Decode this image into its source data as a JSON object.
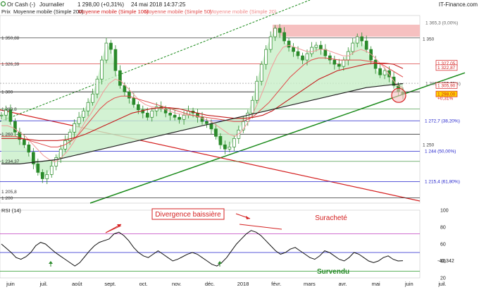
{
  "header": {
    "instrument": "Or Cash (-)",
    "period": "Journalier",
    "quote": "1 298,00 (+0,31%)",
    "datetime": "24 mai 2018 14:37:25",
    "source": "IT-Finance.com"
  },
  "legend": {
    "prefix": "Prix",
    "items": [
      {
        "label": "Moyenne mobile (Simple 200)",
        "color": "#222222"
      },
      {
        "label": "Moyenne mobile (Simple 100)",
        "color": "#d42020"
      },
      {
        "label": "Moyenne mobile (Simple 50)",
        "color": "#e05050"
      },
      {
        "label": "Moyenne mobile (Simple 20)",
        "color": "#f08a8a"
      }
    ]
  },
  "colors": {
    "candle_up": "#2a8a2a",
    "candle_down": "#2a8a2a",
    "sma200": "#222222",
    "sma100": "#c41a1a",
    "sma50": "#e04848",
    "sma20": "#f29a9a",
    "support_line": "#1a8a1a",
    "resistance_line": "#d42020",
    "fib_line": "#2222cc",
    "rsi_line": "#111111",
    "rsi_upper": "#c040c0",
    "rsi_lower": "#2a9a2a",
    "annotation_red": "#d42020",
    "annotation_green": "#2a8a2a",
    "zone_red": "#f6c0c0",
    "zone_green": "#c8efc8"
  },
  "chart_data": {
    "type": "candlestick",
    "x_labels": [
      "juin",
      "juil.",
      "août",
      "sept.",
      "oct.",
      "nov.",
      "déc.",
      "2018",
      "févr.",
      "mars",
      "avr.",
      "mai",
      "juin",
      "juil."
    ],
    "y_ticks": [
      "1 350",
      "1 300",
      "1 250",
      "1 200"
    ],
    "ylim": [
      1195,
      1372
    ],
    "price_series": [
      1278,
      1283,
      1272,
      1262,
      1255,
      1250,
      1243,
      1232,
      1224,
      1218,
      1222,
      1230,
      1238,
      1246,
      1254,
      1262,
      1270,
      1276,
      1282,
      1290,
      1298,
      1312,
      1330,
      1346,
      1340,
      1320,
      1306,
      1300,
      1294,
      1288,
      1283,
      1280,
      1276,
      1282,
      1286,
      1284,
      1280,
      1278,
      1276,
      1274,
      1278,
      1282,
      1280,
      1276,
      1272,
      1270,
      1265,
      1258,
      1250,
      1246,
      1248,
      1256,
      1264,
      1272,
      1280,
      1292,
      1310,
      1326,
      1340,
      1352,
      1360,
      1356,
      1348,
      1342,
      1338,
      1334,
      1330,
      1336,
      1342,
      1344,
      1340,
      1334,
      1330,
      1326,
      1324,
      1330,
      1338,
      1346,
      1352,
      1348,
      1340,
      1330,
      1322,
      1316,
      1320,
      1314,
      1306,
      1300,
      1298
    ],
    "sma20": [
      1268,
      1268,
      1266,
      1262,
      1258,
      1252,
      1246,
      1240,
      1236,
      1234,
      1238,
      1244,
      1252,
      1262,
      1272,
      1280,
      1290,
      1300,
      1308,
      1312,
      1310,
      1304,
      1298,
      1292,
      1288,
      1286,
      1285,
      1284,
      1282,
      1280,
      1279,
      1278,
      1278,
      1276,
      1274,
      1272,
      1268,
      1264,
      1260,
      1258,
      1262,
      1270,
      1280,
      1292,
      1306,
      1322,
      1334,
      1342,
      1344,
      1342,
      1340,
      1338,
      1338,
      1340,
      1340,
      1338,
      1336,
      1334,
      1334,
      1338,
      1340,
      1338,
      1334,
      1328,
      1322,
      1314,
      1306,
      1304
    ],
    "sma50": [
      1258,
      1258,
      1258,
      1256,
      1254,
      1252,
      1250,
      1248,
      1248,
      1250,
      1254,
      1260,
      1268,
      1276,
      1284,
      1290,
      1294,
      1296,
      1296,
      1294,
      1292,
      1290,
      1288,
      1286,
      1284,
      1282,
      1280,
      1278,
      1277,
      1276,
      1275,
      1274,
      1273,
      1272,
      1272,
      1274,
      1278,
      1284,
      1290,
      1298,
      1306,
      1314,
      1320,
      1326,
      1330,
      1332,
      1332,
      1331,
      1330,
      1330,
      1330,
      1330,
      1329,
      1328,
      1326,
      1322,
      1318,
      1314
    ],
    "sma100": [
      1256,
      1256,
      1256,
      1255,
      1254,
      1254,
      1254,
      1255,
      1257,
      1260,
      1264,
      1268,
      1272,
      1276,
      1280,
      1282,
      1284,
      1285,
      1285,
      1284,
      1282,
      1280,
      1278,
      1277,
      1276,
      1275,
      1275,
      1276,
      1278,
      1282,
      1288,
      1294,
      1300,
      1306,
      1312,
      1316,
      1320,
      1322,
      1324,
      1326,
      1327,
      1327,
      1326,
      1322
    ],
    "sma200": [
      1232,
      1232,
      1234,
      1236,
      1240,
      1244,
      1248,
      1252,
      1256,
      1260,
      1264,
      1268,
      1272,
      1276,
      1280,
      1284,
      1288,
      1292,
      1296,
      1300,
      1304,
      1306,
      1307.8
    ],
    "rsi_ylim": [
      20,
      100
    ],
    "rsi_ticks": [
      100,
      80,
      60,
      40,
      20
    ],
    "rsi_series": [
      60,
      55,
      50,
      44,
      42,
      45,
      50,
      58,
      62,
      60,
      55,
      50,
      46,
      42,
      38,
      34,
      38,
      45,
      52,
      58,
      62,
      64,
      66,
      72,
      74,
      70,
      64,
      56,
      50,
      46,
      44,
      48,
      52,
      48,
      44,
      40,
      42,
      45,
      48,
      50,
      48,
      44,
      40,
      36,
      34,
      38,
      44,
      52,
      60,
      66,
      72,
      76,
      74,
      70,
      64,
      58,
      52,
      48,
      50,
      54,
      56,
      52,
      48,
      44,
      42,
      46,
      52,
      50,
      46,
      42,
      40,
      44,
      50,
      48,
      44,
      40,
      38,
      40,
      44,
      46,
      42,
      40,
      40.342
    ]
  },
  "price_labels": [
    {
      "text": "1 365,3 (0,00%)",
      "price": 1365.3
    },
    {
      "text": "1 350",
      "price": 1350
    },
    {
      "text": "1 350,88",
      "price": 1350.88
    },
    {
      "text": "1 327,05",
      "price": 1327.05
    },
    {
      "text": "1 326,39",
      "price": 1326.39
    },
    {
      "text": "1 322,87",
      "price": 1322.87
    },
    {
      "text": "1 308,1 (23,60%)",
      "price": 1308.1
    },
    {
      "text": "1 307,79",
      "price": 1307.79
    },
    {
      "text": "1 305,90",
      "price": 1305.9
    },
    {
      "text": "1 300",
      "price": 1300
    },
    {
      "text": "1 298,00",
      "price": 1298
    },
    {
      "text": "+0,31%",
      "price": 1294
    },
    {
      "text": "1 283,8",
      "price": 1283.8
    },
    {
      "text": "1 272,7 (38,20%)",
      "price": 1272.7
    },
    {
      "text": "1 260",
      "price": 1260
    },
    {
      "text": "1 250",
      "price": 1250
    },
    {
      "text": "1 244 (50,00%)",
      "price": 1244
    },
    {
      "text": "1 234,37",
      "price": 1234.37
    },
    {
      "text": "1 215,4 (61,80%)",
      "price": 1215.4
    },
    {
      "text": "1 205,8",
      "price": 1205.8
    },
    {
      "text": "1 200",
      "price": 1200
    }
  ],
  "rsi_panel": {
    "title": "RSI (14)",
    "value": "40,342"
  },
  "annotations": {
    "divergence": "Divergence baissière",
    "overbought": "Suracheté",
    "oversold": "Survendu"
  }
}
